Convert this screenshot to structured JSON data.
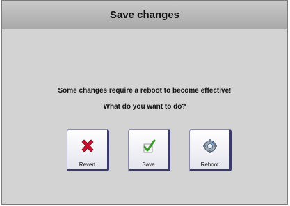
{
  "dialog": {
    "title": "Save changes",
    "message_line1": "Some changes require a reboot to become effective!",
    "message_line2": "What do you want to do?"
  },
  "buttons": {
    "revert": {
      "label": "Revert",
      "icon": "red-x-icon"
    },
    "save": {
      "label": "Save",
      "icon": "green-checkmark-icon"
    },
    "reboot": {
      "label": "Reboot",
      "icon": "gear-reboot-icon"
    }
  },
  "colors": {
    "revert_icon": "#c8102e",
    "save_icon": "#3a9a2a",
    "button_border": "#3a3a6a"
  }
}
